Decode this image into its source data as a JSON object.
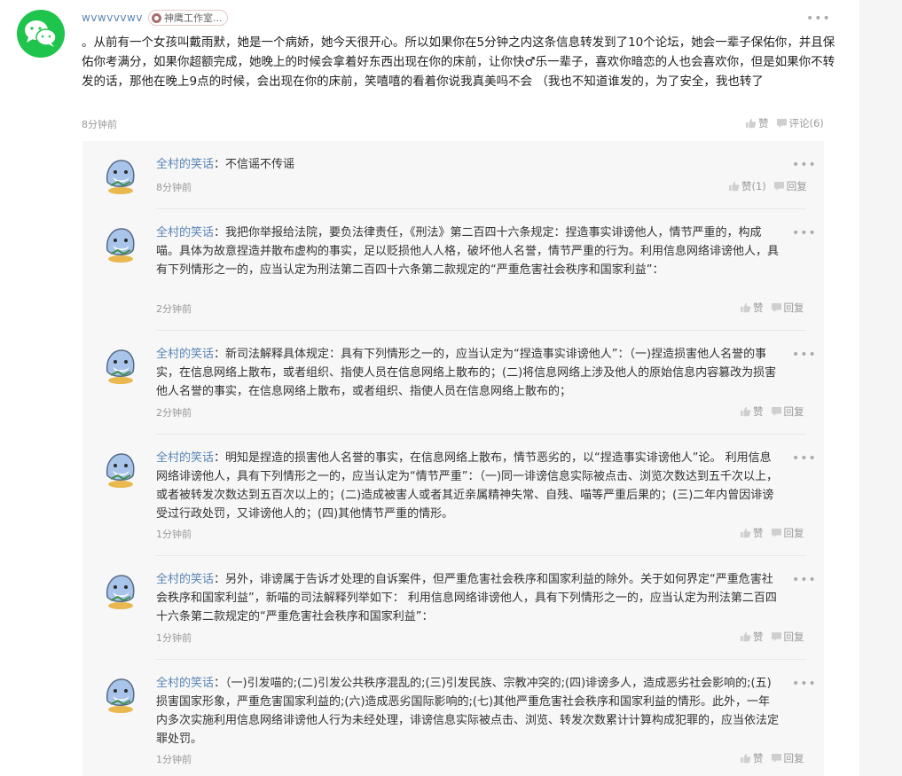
{
  "post": {
    "author": "wvwvvvwv",
    "badge": "神鹰工作室...",
    "body": "。从前有一个女孩叫戴雨默，她是一个病娇，她今天很开心。所以如果你在5分钟之内这条信息转发到了10个论坛，她会一辈子保佑你，并且保佑你考满分，如果你超额完成，她晚上的时候会拿着好东西出现在你的床前，让你快♂乐一辈子，喜欢你暗恋的人也会喜欢你，但是如果你不转发的话，那他在晚上9点的时候，会出现在你的床前，笑嘻嘻的看着你说我真美吗不会 （我也不知道谁发的，为了安全，我也转了",
    "time": "8分钟前",
    "like_label": "赞",
    "comment_label": "评论(6)"
  },
  "comments": [
    {
      "author": "全村的笑话",
      "separator": "：",
      "text": "不信谣不传谣",
      "time": "8分钟前",
      "like_label": "赞(1)",
      "reply_label": "回复"
    },
    {
      "author": "全村的笑话",
      "separator": "：",
      "text": "我把你举报给法院，要负法律责任，《刑法》第二百四十六条规定：捏造事实诽谤他人，情节严重的，构成喵。具体为故意捏造并散布虚构的事实，足以贬损他人人格，破坏他人名誉，情节严重的行为。利用信息网络诽谤他人，具有下列情形之一的，应当认定为刑法第二百四十六条第二款规定的“严重危害社会秩序和国家利益”：",
      "time": "2分钟前",
      "like_label": "赞",
      "reply_label": "回复"
    },
    {
      "author": "全村的笑话",
      "separator": "：",
      "text": "新司法解释具体规定：具有下列情形之一的，应当认定为“捏造事实诽谤他人”：（一)捏造损害他人名誉的事实，在信息网络上散布，或者组织、指使人员在信息网络上散布的；(二)将信息网络上涉及他人的原始信息内容篡改为损害他人名誉的事实，在信息网络上散布，或者组织、指使人员在信息网络上散布的；",
      "time": "2分钟前",
      "like_label": "赞",
      "reply_label": "回复"
    },
    {
      "author": "全村的笑话",
      "separator": "：",
      "text": "明知是捏造的损害他人名誉的事实，在信息网络上散布，情节恶劣的，以“捏造事实诽谤他人”论。 利用信息网络诽谤他人，具有下列情形之一的，应当认定为“情节严重”：（一)同一诽谤信息实际被点击、浏览次数达到五千次以上，或者被转发次数达到五百次以上的；(二)造成被害人或者其近亲属精神失常、自残、喵等严重后果的；(三)二年内曾因诽谤受过行政处罚，又诽谤他人的；(四)其他情节严重的情形。",
      "time": "1分钟前",
      "like_label": "赞",
      "reply_label": "回复"
    },
    {
      "author": "全村的笑话",
      "separator": "：",
      "text": "另外，诽谤属于告诉才处理的自诉案件，但严重危害社会秩序和国家利益的除外。关于如何界定“严重危害社会秩序和国家利益”，新喵的司法解释列举如下： 利用信息网络诽谤他人，具有下列情形之一的，应当认定为刑法第二百四十六条第二款规定的“严重危害社会秩序和国家利益”：",
      "time": "1分钟前",
      "like_label": "赞",
      "reply_label": "回复"
    },
    {
      "author": "全村的笑话",
      "separator": "：",
      "text": "（一)引发喵的;(二)引发公共秩序混乱的;(三)引发民族、宗教冲突的;(四)诽谤多人，造成恶劣社会影响的;(五)损害国家形象，严重危害国家利益的;(六)造成恶劣国际影响的;(七)其他严重危害社会秩序和国家利益的情形。此外，一年内多次实施利用信息网络诽谤他人行为未经处理，诽谤信息实际被点击、浏览、转发次数累计计算构成犯罪的，应当依法定罪处罚。",
      "time": "1分钟前",
      "like_label": "赞",
      "reply_label": "回复"
    }
  ],
  "icons": {
    "post_avatar": "wechat-logo-icon",
    "comment_avatar": "cartoon-shark-avatar-icon",
    "more": "more-dots-icon",
    "like": "thumbs-up-icon",
    "comment": "comment-bubble-icon",
    "reply": "reply-bubble-icon"
  },
  "colors": {
    "brand_green": "#1ec44b",
    "author_link": "#5a84b5",
    "muted": "#999999",
    "comment_bg": "#f7f7f7"
  }
}
